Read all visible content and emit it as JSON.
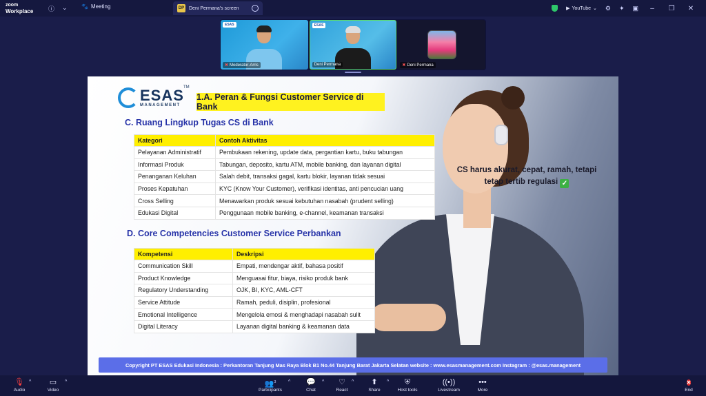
{
  "app": {
    "logo_line1": "zoom",
    "logo_line2": "Workplace"
  },
  "titlebar": {
    "meeting_tab": "Meeting",
    "share_tab_badge": "DP",
    "share_tab_label": "Deni Permana's screen",
    "youtube_label": "YouTube"
  },
  "participants_strip": [
    {
      "name": "Moderator-Arris",
      "logo": "ESAS",
      "muted": true
    },
    {
      "name": "Deni Permana",
      "logo": "ESAS",
      "muted": false
    },
    {
      "name": "Deni Permana",
      "muted": true
    }
  ],
  "slide": {
    "logo_word": "ESAS",
    "logo_sub": "MANAGEMENT",
    "logo_tm": "TM",
    "title": "1.A. Peran & Fungsi Customer Service di Bank",
    "section_c": "C. Ruang Lingkup Tugas CS di Bank",
    "table1": {
      "headers": [
        "Kategori",
        "Contoh Aktivitas"
      ],
      "rows": [
        [
          "Pelayanan Administratif",
          "Pembukaan rekening, update data, pergantian kartu, buku tabungan"
        ],
        [
          "Informasi Produk",
          "Tabungan, deposito, kartu ATM, mobile banking, dan layanan digital"
        ],
        [
          "Penanganan Keluhan",
          "Salah debit, transaksi gagal, kartu blokir, layanan tidak sesuai"
        ],
        [
          "Proses Kepatuhan",
          "KYC (Know Your Customer), verifikasi identitas, anti pencucian uang"
        ],
        [
          "Cross Selling",
          "Menawarkan produk sesuai kebutuhan nasabah (prudent selling)"
        ],
        [
          "Edukasi Digital",
          "Penggunaan mobile banking, e-channel, keamanan transaksi"
        ]
      ]
    },
    "section_d": "D. Core Competencies Customer Service Perbankan",
    "table2": {
      "headers": [
        "Kompetensi",
        "Deskripsi"
      ],
      "rows": [
        [
          "Communication Skill",
          "Empati, mendengar aktif, bahasa positif"
        ],
        [
          "Product Knowledge",
          "Menguasai fitur, biaya, risiko produk bank"
        ],
        [
          "Regulatory Understanding",
          "OJK, BI, KYC, AML-CFT"
        ],
        [
          "Service Attitude",
          "Ramah, peduli, disiplin, profesional"
        ],
        [
          "Emotional Intelligence",
          "Mengelola emosi & menghadapi nasabah sulit"
        ],
        [
          "Digital Literacy",
          "Layanan digital banking & keamanan data"
        ]
      ]
    },
    "callout_line1": "CS harus akurat, cepat, ramah, tetapi",
    "callout_line2": "tetap tertib regulasi",
    "footer": "Copyright PT ESAS Edukasi Indonesia : Perkantoran Tanjung Mas Raya Blok B1 No.44 Tanjung Barat Jakarta Selatan website : www.esasmanagement.com Instagram : @esas.management"
  },
  "toolbar": {
    "audio": "Audio",
    "video": "Video",
    "participants": "Participants",
    "participants_count": "3",
    "chat": "Chat",
    "react": "React",
    "share": "Share",
    "host_tools": "Host tools",
    "livestream": "Livestream",
    "more": "More",
    "end": "End"
  }
}
